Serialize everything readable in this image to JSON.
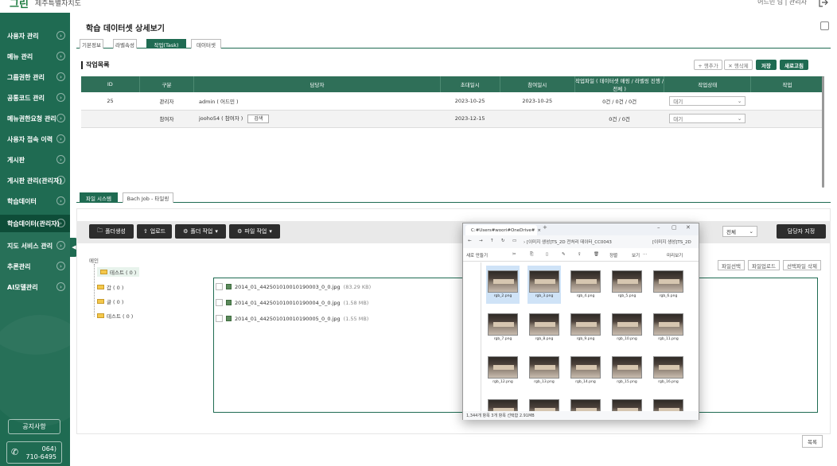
{
  "header": {
    "logo": "그린",
    "subtitle": "제주특별자치도",
    "user_info": "어드민 님 | 관리자"
  },
  "sidebar": {
    "items": [
      {
        "label": "사용자 관리"
      },
      {
        "label": "메뉴 관리"
      },
      {
        "label": "그룹권한 관리"
      },
      {
        "label": "공통코드 관리"
      },
      {
        "label": "메뉴권한요청 관리"
      },
      {
        "label": "사용자 접속 이력"
      },
      {
        "label": "게시판"
      },
      {
        "label": "게시판 관리(관리자)"
      },
      {
        "label": "학습데이터"
      },
      {
        "label": "학습데이터(관리자)"
      },
      {
        "label": "지도 서비스 관리"
      },
      {
        "label": "추론관리"
      },
      {
        "label": "AI모델관리"
      }
    ],
    "notice_label": "공지사항",
    "phone_area": "064)",
    "phone_number": "710-6495"
  },
  "page": {
    "title": "학습 데이터셋 상세보기",
    "tabs": [
      {
        "label": "기본정보"
      },
      {
        "label": "라벨속성"
      },
      {
        "label": "작업(Task)"
      },
      {
        "label": "데이터셋"
      }
    ],
    "active_tab": "작업(Task)"
  },
  "task_list": {
    "section_title": "작업목록",
    "toolbar": {
      "add_row": "+ 행추가",
      "delete_row": "✕ 행삭제",
      "save": "저장",
      "refresh": "새로고침"
    },
    "columns": [
      "ID",
      "구분",
      "담당자",
      "초대일시",
      "참여일시",
      "작업파일 ( 데이터셋 매핑 / 라벨링 진행 / 전체 )",
      "작업상태",
      "작업"
    ],
    "rows": [
      {
        "id": "25",
        "type": "관리자",
        "assignee": "admin ( 어드민 )",
        "invited": "2023-10-25",
        "joined": "2023-10-25",
        "files": "0건 / 0건 / 0건",
        "status": "대기",
        "action_btn": ""
      },
      {
        "id": "",
        "type": "참여자",
        "assignee": "jooho54 ( 참여자 )",
        "invited": "2023-12-15",
        "joined": "",
        "files": "0건 / 0건",
        "status": "대기",
        "action_btn": "검색"
      }
    ]
  },
  "lower_tabs": [
    {
      "label": "파일 시스템"
    },
    {
      "label": "Bach Job - 타일링"
    }
  ],
  "file_toolbar": {
    "make_folder": "폴더생성",
    "upload": "업로드",
    "folder_work": "폴더 작업",
    "file_work": "파일 작업",
    "filter_value": "전체",
    "assign": "담당자 지정"
  },
  "tree": {
    "root": "메인",
    "items": [
      {
        "label": "테스트 ( 0 )"
      },
      {
        "label": "갑 ( 0 )"
      },
      {
        "label": "글 ( 0 )"
      },
      {
        "label": "테스트 ( 0 )"
      }
    ]
  },
  "file_buttons": {
    "select_file": "파일선택",
    "file_upload": "파일업로드",
    "delete_selected": "선택파일 삭제"
  },
  "files": [
    {
      "name": "2014_01_442501010010190003_0_0.jpg",
      "size": "(83.29 KB)"
    },
    {
      "name": "2014_01_442501010010190004_0_0.jpg",
      "size": "(1.58 MB)"
    },
    {
      "name": "2014_01_442501010010190005_0_0.jpg",
      "size": "(1.55 MB)"
    }
  ],
  "list_button": "목록",
  "explorer": {
    "tab_title": "C:#Users#woori#OneDrive#",
    "new_tab": "+",
    "address": "› [이미지 생성]TS_2D 전처리 데이터_CC0043",
    "address_right": "[이미지 생성]TS_2D",
    "toolbar": {
      "new": "새로 만들기",
      "sort": "정렬",
      "view": "보기",
      "more": "···",
      "preview": "미리보기"
    },
    "thumbs": [
      {
        "label": "rgb_2.png"
      },
      {
        "label": "rgb_3.png"
      },
      {
        "label": "rgb_4.png"
      },
      {
        "label": "rgb_5.png"
      },
      {
        "label": "rgb_6.png"
      },
      {
        "label": "rgb_7.png"
      },
      {
        "label": "rgb_8.png"
      },
      {
        "label": "rgb_9.png"
      },
      {
        "label": "rgb_10.png"
      },
      {
        "label": "rgb_11.png"
      },
      {
        "label": "rgb_12.png"
      },
      {
        "label": "rgb_13.png"
      },
      {
        "label": "rgb_14.png"
      },
      {
        "label": "rgb_15.png"
      },
      {
        "label": "rgb_16.png"
      },
      {
        "label": ""
      },
      {
        "label": ""
      },
      {
        "label": ""
      },
      {
        "label": ""
      },
      {
        "label": ""
      }
    ],
    "status": "1,344개 항목   3개 항목 선택함 2.91MB"
  },
  "colors": {
    "brand": "#1f6b52",
    "brand_dark": "#0e4d38",
    "header_row": "#2f6f58"
  }
}
